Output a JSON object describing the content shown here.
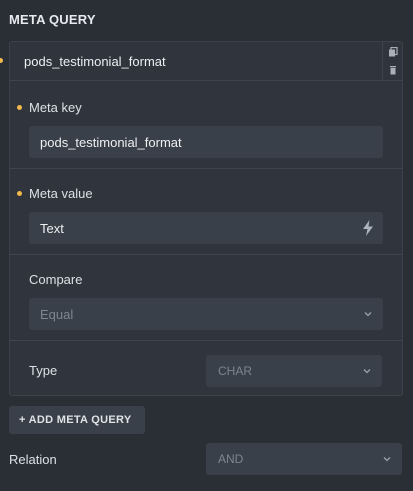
{
  "panel": {
    "title": "META QUERY"
  },
  "group": {
    "title": "pods_testimonial_format",
    "meta_key": {
      "label": "Meta key",
      "value": "pods_testimonial_format"
    },
    "meta_value": {
      "label": "Meta value",
      "value": "Text"
    },
    "compare": {
      "label": "Compare",
      "value": "Equal"
    },
    "type": {
      "label": "Type",
      "value": "CHAR"
    }
  },
  "add_button": {
    "label": "+ ADD META QUERY"
  },
  "relation": {
    "label": "Relation",
    "value": "AND"
  },
  "colors": {
    "accent_dot": "#f2b84b",
    "background": "#2a2f36",
    "panel": "#30353d",
    "input": "#3a4049"
  },
  "icons": [
    "copy-icon",
    "trash-icon",
    "bolt-icon",
    "chevron-down-icon"
  ]
}
